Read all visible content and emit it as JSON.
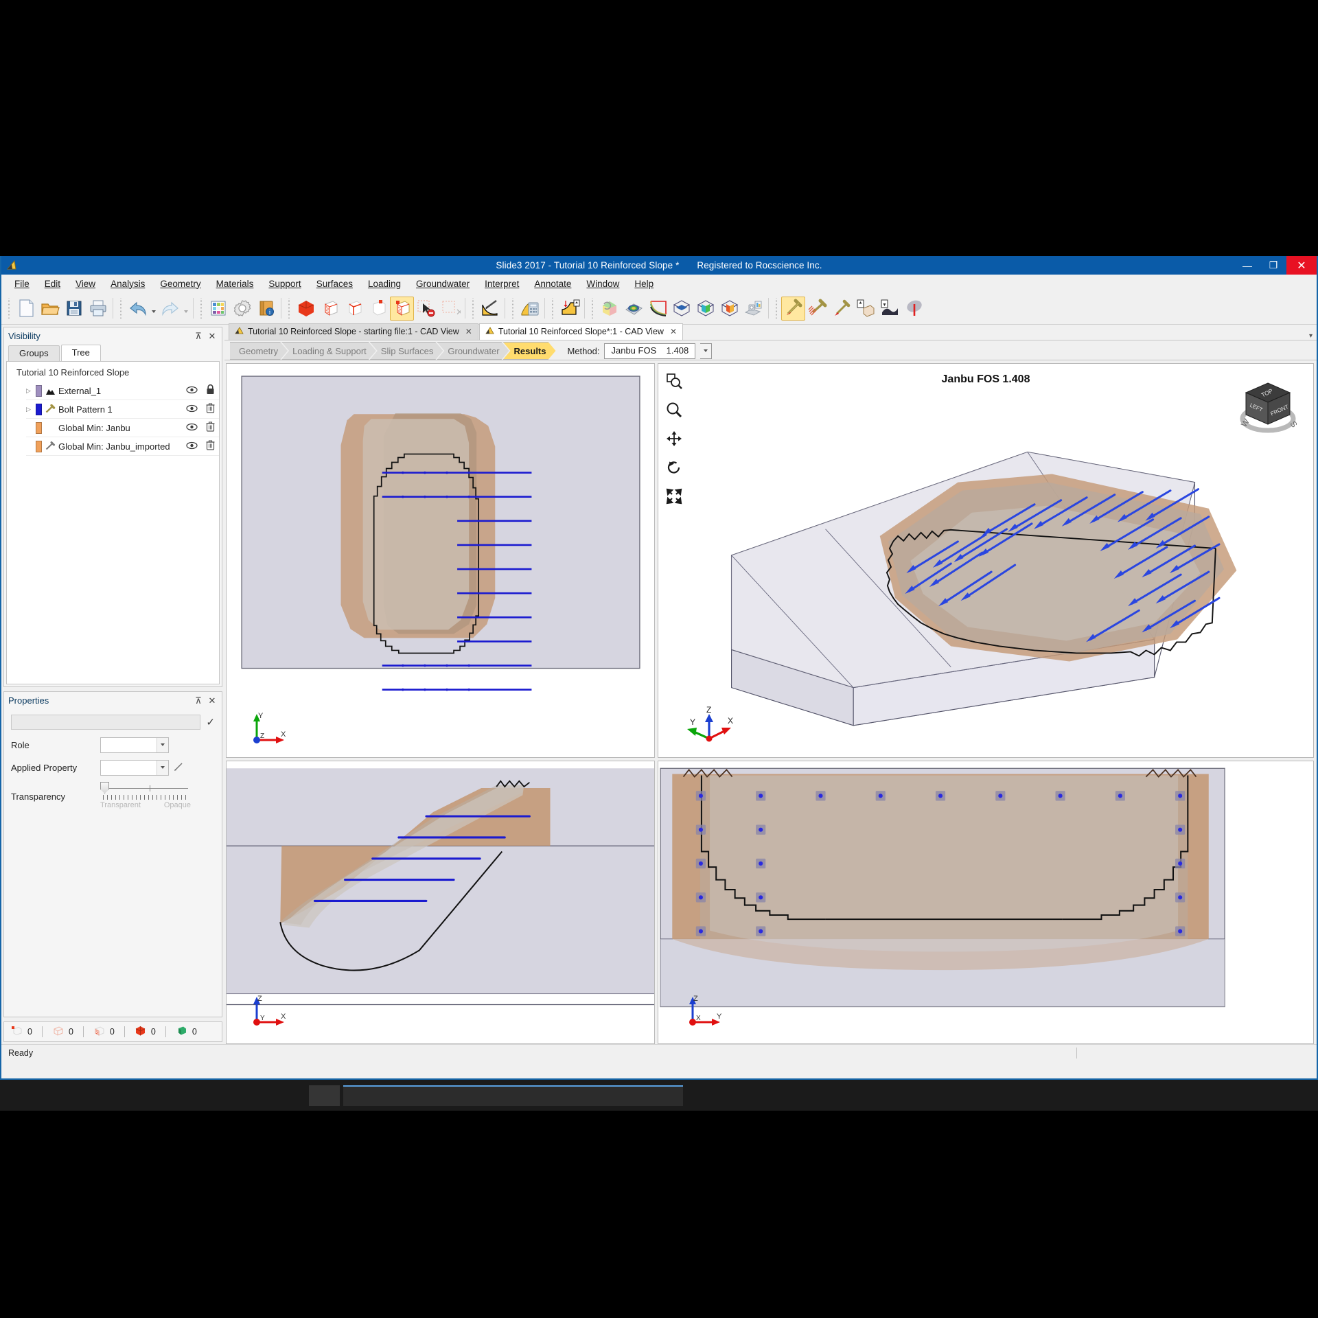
{
  "window": {
    "title": "Slide3 2017 - Tutorial 10 Reinforced Slope *",
    "registration": "Registered to Rocscience Inc.",
    "app_icon": "slide3-logo-icon",
    "minimize": "—",
    "maximize": "❐",
    "close": "✕"
  },
  "menu": {
    "items": [
      {
        "label": "File"
      },
      {
        "label": "Edit"
      },
      {
        "label": "View"
      },
      {
        "label": "Analysis"
      },
      {
        "label": "Geometry"
      },
      {
        "label": "Materials"
      },
      {
        "label": "Support"
      },
      {
        "label": "Surfaces"
      },
      {
        "label": "Loading"
      },
      {
        "label": "Groundwater"
      },
      {
        "label": "Interpret"
      },
      {
        "label": "Annotate"
      },
      {
        "label": "Window"
      },
      {
        "label": "Help"
      }
    ]
  },
  "toolbar": {
    "groups": [
      {
        "icons": [
          "new-document-icon",
          "open-folder-icon",
          "save-disk-icon",
          "print-icon"
        ]
      },
      {
        "icons": [
          "undo-arrow-icon",
          "redo-arrow-icon"
        ]
      },
      {
        "icons": [
          "color-palette-icon",
          "settings-gear-icon",
          "project-settings-book-icon"
        ]
      },
      {
        "icons": [
          "solid-cube-icon",
          "select-faces-cube-icon",
          "select-edges-cube-icon",
          "select-vertex-cube-icon",
          "select-body-cube-icon",
          "pick-cursor-icon",
          "deselect-all-icon"
        ]
      },
      {
        "icons": [
          "draw-slip-surface-icon",
          "compute-calculator-icon",
          "export-slope-icon"
        ]
      },
      {
        "icons": [
          "refresh-contour-icon",
          "contour-results-icon",
          "surface-search-icon",
          "plane-section-z-icon",
          "plane-section-y-icon",
          "plane-section-x-icon",
          "clipping-plane-icon"
        ]
      },
      {
        "icons": [
          "display-options-icon",
          "add-bolt-icon",
          "bolt-pattern-icon",
          "single-bolt-icon",
          "import-bolt-icon",
          "add-surface-icon",
          "pin-support-icon"
        ]
      }
    ]
  },
  "visibility_panel": {
    "title": "Visibility",
    "pin_icon": "pin-icon",
    "close_icon": "close-icon",
    "tabs": [
      {
        "label": "Groups",
        "selected": false
      },
      {
        "label": "Tree",
        "selected": true
      }
    ],
    "root_label": "Tutorial 10 Reinforced Slope",
    "nodes": [
      {
        "label": "External_1",
        "swatch": "#9f8fbf",
        "icon": "mountain-icon",
        "expandable": true,
        "eye_icon": "eye-icon",
        "action_icon": "lock-icon"
      },
      {
        "label": "Bolt Pattern 1",
        "swatch": "#1b1bd0",
        "icon": "bolt-icon",
        "expandable": true,
        "eye_icon": "eye-icon",
        "action_icon": "trash-icon"
      },
      {
        "label": "Global Min: Janbu",
        "swatch": "#f0a05a",
        "icon": "none",
        "expandable": false,
        "eye_icon": "eye-icon",
        "action_icon": "trash-icon"
      },
      {
        "label": "Global Min: Janbu_imported",
        "swatch": "#f0a05a",
        "icon": "bolt-icon",
        "expandable": false,
        "eye_icon": "eye-icon",
        "action_icon": "trash-icon"
      }
    ]
  },
  "properties_panel": {
    "title": "Properties",
    "pin_icon": "pin-icon",
    "close_icon": "close-icon",
    "name_value": "",
    "name_placeholder": "",
    "confirm_icon": "checkmark-icon",
    "rows": [
      {
        "label": "Role",
        "value": "",
        "control": "combobox"
      },
      {
        "label": "Applied Property",
        "value": "",
        "control": "combobox",
        "edit_icon": "pencil-icon"
      }
    ],
    "transparency": {
      "label": "Transparency",
      "min_label": "Transparent",
      "max_label": "Opaque",
      "value_pct": 0
    }
  },
  "counters": {
    "items": [
      {
        "icon": "vertex-count-icon",
        "value": "0"
      },
      {
        "icon": "edge-count-icon",
        "value": "0"
      },
      {
        "icon": "face-count-icon",
        "value": "0"
      },
      {
        "icon": "solid-count-icon",
        "value": "0"
      },
      {
        "icon": "green-solid-count-icon",
        "value": "0"
      }
    ]
  },
  "document_tabs": {
    "tabs": [
      {
        "label": "Tutorial 10 Reinforced Slope - starting file:1 - CAD View",
        "selected": false,
        "icon": "cad-view-icon",
        "close_icon": "close-icon"
      },
      {
        "label": "Tutorial 10 Reinforced Slope*:1 - CAD View",
        "selected": true,
        "icon": "cad-view-icon",
        "close_icon": "close-icon"
      }
    ],
    "overflow_icon": "chevron-down-icon"
  },
  "workflow": {
    "steps": [
      {
        "label": "Geometry",
        "selected": false
      },
      {
        "label": "Loading & Support",
        "selected": false
      },
      {
        "label": "Slip Surfaces",
        "selected": false
      },
      {
        "label": "Groundwater",
        "selected": false
      },
      {
        "label": "Results",
        "selected": true
      }
    ],
    "method_label": "Method:",
    "method_value": "Janbu FOS    1.408",
    "method_caret_icon": "chevron-down-icon"
  },
  "viewports": {
    "top_left": {
      "name": "top-view",
      "axes": {
        "up": "Y",
        "right": "X",
        "out": "Z"
      }
    },
    "top_right": {
      "name": "perspective-3d-view",
      "title": "Janbu FOS 1.408",
      "nav_buttons": [
        {
          "icon": "zoom-window-icon"
        },
        {
          "icon": "zoom-icon"
        },
        {
          "icon": "pan-icon"
        },
        {
          "icon": "rotate-icon"
        },
        {
          "icon": "zoom-extents-icon"
        }
      ],
      "axes": {
        "up": "Z",
        "right": "X",
        "left": "Y"
      },
      "view_cube": {
        "top": "TOP",
        "left": "LEFT",
        "front": "FRONT",
        "west": "W",
        "south": "S"
      }
    },
    "bottom_left": {
      "name": "front-section-view",
      "axes": {
        "up": "Z",
        "right": "X",
        "out": "Y"
      }
    },
    "bottom_right": {
      "name": "side-section-view",
      "axes": {
        "up": "Z",
        "right": "Y",
        "out": "X"
      }
    }
  },
  "statusbar": {
    "message": "Ready"
  },
  "colors": {
    "accent": "#0a5ba8",
    "selected_step": "#ffdc6e",
    "bolt_blue": "#1b1bd0",
    "soil_brown": "#c09070",
    "slip_surface": "#b6a696",
    "model_gray": "#d7d6e0"
  }
}
